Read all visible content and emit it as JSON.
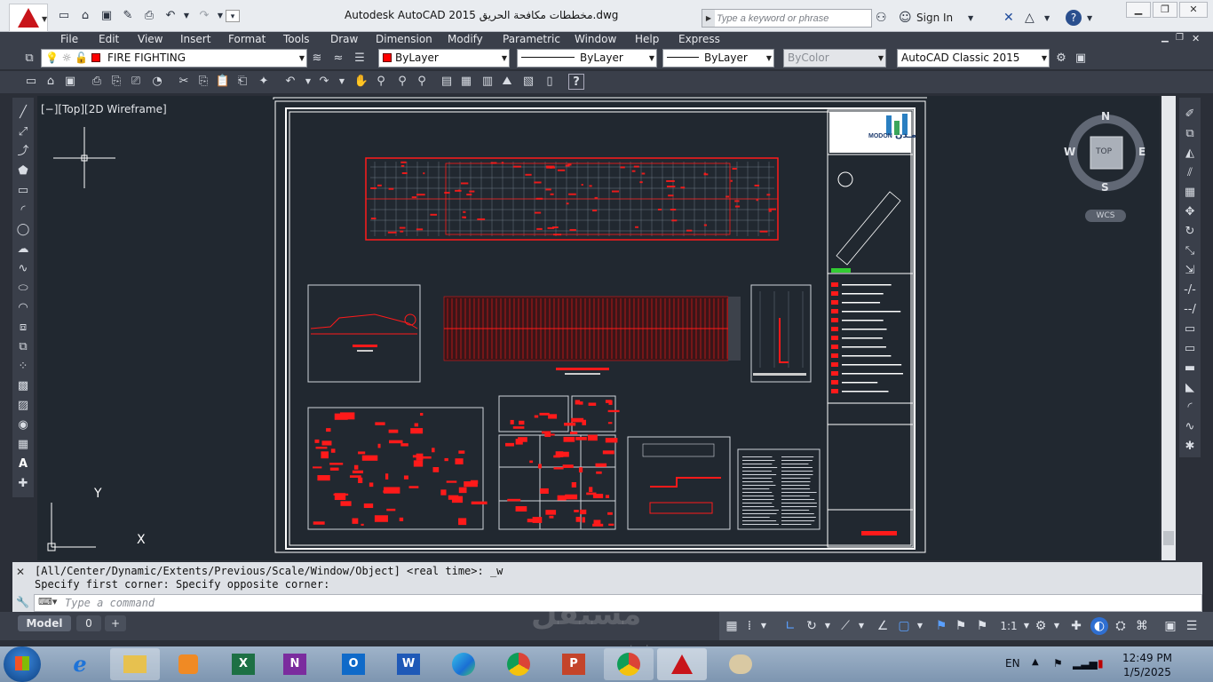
{
  "window": {
    "title": "Autodesk AutoCAD 2015   مخططات مكافحة الحريق.dwg",
    "search_placeholder": "Type a keyword or phrase",
    "sign_in": "Sign In"
  },
  "menu": [
    "File",
    "Edit",
    "View",
    "Insert",
    "Format",
    "Tools",
    "Draw",
    "Dimension",
    "Modify",
    "Parametric",
    "Window",
    "Help",
    "Express"
  ],
  "toolbar1": {
    "layer": "FIRE FIGHTING",
    "color": "ByLayer",
    "linetype": "ByLayer",
    "lineweight": "ByLayer",
    "plotstyle": "ByColor",
    "workspace": "AutoCAD Classic 2015"
  },
  "viewport": {
    "label": "[−][Top][2D Wireframe]",
    "ucs_x": "X",
    "ucs_y": "Y"
  },
  "viewcube": {
    "n": "N",
    "s": "S",
    "e": "E",
    "w": "W",
    "face": "TOP",
    "wcs": "WCS"
  },
  "titleblock": {
    "logo_text": "MODON",
    "logo_arabic": "مـدن"
  },
  "command": {
    "history1": "[All/Center/Dynamic/Extents/Previous/Scale/Window/Object] <real time>: _w",
    "history2": "Specify first corner: Specify opposite corner:",
    "placeholder": "Type a command"
  },
  "layout_tabs": [
    "Model",
    "0",
    "+"
  ],
  "status": {
    "scale": "1:1"
  },
  "taskbar": {
    "apps": [
      "start",
      "internet-explorer",
      "file-explorer",
      "media-player",
      "excel",
      "onenote",
      "outlook",
      "word",
      "edge",
      "chrome",
      "powerpoint",
      "chrome-profile",
      "autocad",
      "paint"
    ],
    "lang": "EN",
    "time": "12:49 PM",
    "date": "1/5/2025"
  },
  "watermark": {
    "text": "مستقل",
    "sub": "mostaql.com"
  },
  "colors": {
    "accent": "#ff1a1a",
    "canvas": "#212830",
    "ui": "#3a3f4a"
  }
}
